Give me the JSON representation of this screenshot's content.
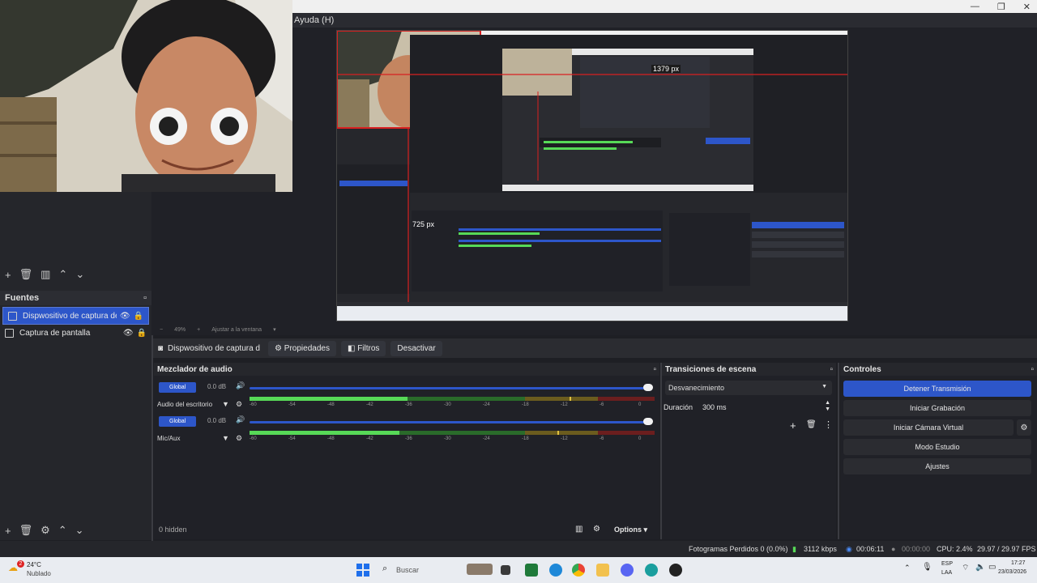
{
  "window": {
    "menu_item": "Ayuda (H)",
    "controls": [
      "—",
      "❐",
      "✕"
    ]
  },
  "preview_inner": {
    "px_label_1": "1379 px",
    "px_label_2": "725 px"
  },
  "zoom": {
    "minus": "−",
    "value": "49%",
    "plus": "+",
    "fit_label": "Ajustar a la ventana"
  },
  "sources": {
    "title": "Fuentes",
    "items": [
      {
        "label": "Dispwositivo de captura de vic",
        "selected": true
      },
      {
        "label": "Captura de pantalla",
        "selected": false
      }
    ]
  },
  "source_toolbar": {
    "name": "Dispwositivo de captura d",
    "properties": "Propiedades",
    "filters": "Filtros",
    "deactivate": "Desactivar"
  },
  "mixer": {
    "title": "Mezclador de audio",
    "channels": [
      {
        "badge": "Global",
        "db": "0.0 dB",
        "name": "Audio del escritorio",
        "level": 0.39,
        "peak": 0.79
      },
      {
        "badge": "Global",
        "db": "0.0 dB",
        "name": "Mic/Aux",
        "level": 0.37,
        "peak": 0.76
      }
    ],
    "ticks": [
      "-60",
      "-54",
      "-48",
      "-42",
      "-36",
      "-30",
      "-24",
      "-18",
      "-12",
      "-6",
      "0"
    ],
    "hidden": "0 hidden",
    "options": "Options"
  },
  "transitions": {
    "title": "Transiciones de escena",
    "selected": "Desvanecimiento",
    "duration_label": "Duración",
    "duration_value": "300 ms"
  },
  "controls": {
    "title": "Controles",
    "stop_stream": "Detener Transmisión",
    "start_recording": "Iniciar Grabación",
    "start_virtual_cam": "Iniciar Cámara Virtual",
    "studio_mode": "Modo Estudio",
    "settings": "Ajustes"
  },
  "status": {
    "dropped_frames": "Fotogramas Perdidos 0 (0.0%)",
    "bitrate": "3112 kbps",
    "stream_time": "00:06:11",
    "record_time": "00:00:00",
    "cpu": "CPU: 2.4%",
    "fps": "29.97 / 29.97 FPS"
  },
  "taskbar": {
    "weather_temp": "24°C",
    "weather_desc": "Nublado",
    "search": "Buscar",
    "lang_top": "ESP",
    "lang_bottom": "LAA",
    "time": "17:27",
    "date": "23/03/2026",
    "badge": "2"
  },
  "colors": {
    "accent": "#2d56c9",
    "panel": "#202127",
    "meter_green": "#57d957"
  }
}
